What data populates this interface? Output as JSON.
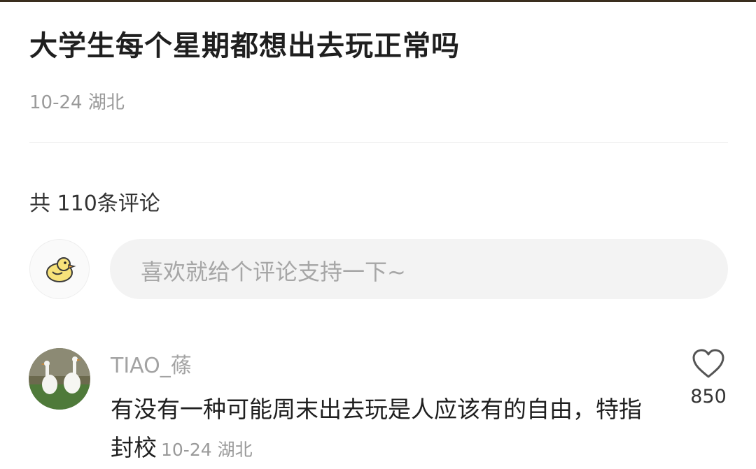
{
  "post": {
    "title": "大学生每个星期都想出去玩正常吗",
    "meta": "10-24 湖北"
  },
  "comments_section": {
    "count_label": "共 110条评论",
    "input_placeholder": "喜欢就给个评论支持一下~"
  },
  "comments": [
    {
      "username": "TIAO_蓧",
      "text": "有没有一种可能周末出去玩是人应该有的自由，特指封校",
      "meta": "10-24 湖北",
      "likes": "850"
    }
  ],
  "icons": {
    "self_avatar": "duck-avatar-icon",
    "like": "heart-icon"
  },
  "colors": {
    "input_bg": "#f3f3f3",
    "muted_text": "#9a9a9a",
    "duck_yellow": "#f7e27a"
  }
}
